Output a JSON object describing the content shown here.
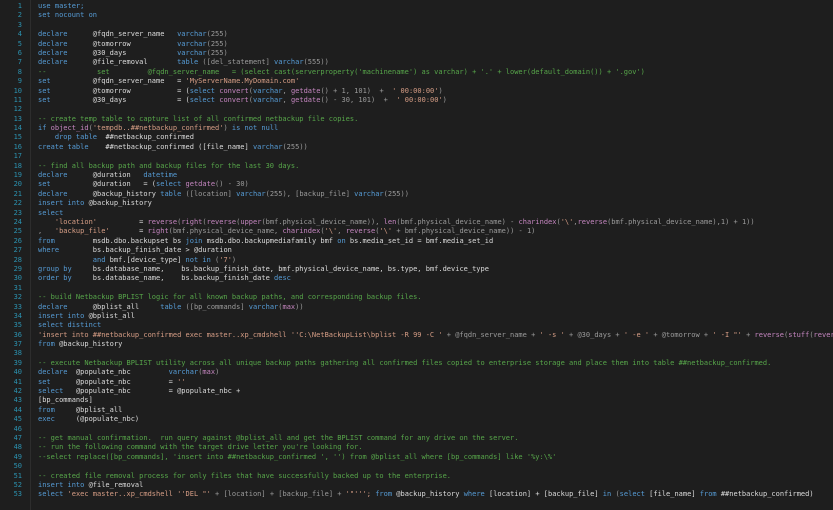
{
  "colors": {
    "background": "#1e1e1e",
    "line_number": "#2b91af",
    "keyword": "#569cd6",
    "string": "#d69d85",
    "comment": "#57a64a",
    "function": "#d4b35c",
    "text": "#dcdcdc"
  },
  "lines": [
    {
      "n": "1",
      "tokens": [
        {
          "t": "k",
          "v": "use master;"
        }
      ]
    },
    {
      "n": "2",
      "tokens": [
        {
          "t": "k",
          "v": "set nocount on"
        }
      ]
    },
    {
      "n": "3",
      "tokens": []
    },
    {
      "n": "4",
      "tokens": [
        {
          "t": "k",
          "v": "declare"
        },
        {
          "t": "v",
          "v": "      @fqdn_server_name   "
        },
        {
          "t": "k",
          "v": "varchar"
        },
        {
          "t": "o",
          "v": "(255)"
        }
      ]
    },
    {
      "n": "5",
      "tokens": [
        {
          "t": "k",
          "v": "declare"
        },
        {
          "t": "v",
          "v": "      @tomorrow           "
        },
        {
          "t": "k",
          "v": "varchar"
        },
        {
          "t": "o",
          "v": "(255)"
        }
      ]
    },
    {
      "n": "6",
      "tokens": [
        {
          "t": "k",
          "v": "declare"
        },
        {
          "t": "v",
          "v": "      @30_days            "
        },
        {
          "t": "k",
          "v": "varchar"
        },
        {
          "t": "o",
          "v": "(255)"
        }
      ]
    },
    {
      "n": "7",
      "tokens": [
        {
          "t": "k",
          "v": "declare"
        },
        {
          "t": "v",
          "v": "      @file_removal       "
        },
        {
          "t": "k",
          "v": "table"
        },
        {
          "t": "o",
          "v": " ([del_statement] "
        },
        {
          "t": "k",
          "v": "varchar"
        },
        {
          "t": "o",
          "v": "(555))"
        }
      ]
    },
    {
      "n": "8",
      "tokens": [
        {
          "t": "c",
          "v": "--            set         @fqdn_server_name   = (select cast(serverproperty('machinename') as varchar) + '.' + lower(default_domain()) + '.gov')"
        }
      ]
    },
    {
      "n": "9",
      "tokens": [
        {
          "t": "k",
          "v": "set"
        },
        {
          "t": "v",
          "v": "          @fqdn_server_name   = "
        },
        {
          "t": "s",
          "v": "'MyServerName.MyDomain.com'"
        }
      ]
    },
    {
      "n": "10",
      "tokens": [
        {
          "t": "k",
          "v": "set"
        },
        {
          "t": "v",
          "v": "          @tomorrow           = ("
        },
        {
          "t": "k",
          "v": "select"
        },
        {
          "t": "v",
          "v": " "
        },
        {
          "t": "g",
          "v": "convert"
        },
        {
          "t": "o",
          "v": "("
        },
        {
          "t": "k",
          "v": "varchar"
        },
        {
          "t": "o",
          "v": ", "
        },
        {
          "t": "g",
          "v": "getdate"
        },
        {
          "t": "o",
          "v": "() + 1, 101)  +  "
        },
        {
          "t": "s",
          "v": "' 00:00:00'"
        },
        {
          "t": "o",
          "v": ")"
        }
      ]
    },
    {
      "n": "11",
      "tokens": [
        {
          "t": "k",
          "v": "set"
        },
        {
          "t": "v",
          "v": "          @30_days            = ("
        },
        {
          "t": "k",
          "v": "select"
        },
        {
          "t": "v",
          "v": " "
        },
        {
          "t": "g",
          "v": "convert"
        },
        {
          "t": "o",
          "v": "("
        },
        {
          "t": "k",
          "v": "varchar"
        },
        {
          "t": "o",
          "v": ", "
        },
        {
          "t": "g",
          "v": "getdate"
        },
        {
          "t": "o",
          "v": "() - 30, 101)  +  "
        },
        {
          "t": "s",
          "v": "' 00:00:00'"
        },
        {
          "t": "o",
          "v": ")"
        }
      ]
    },
    {
      "n": "12",
      "tokens": []
    },
    {
      "n": "13",
      "tokens": [
        {
          "t": "c",
          "v": "-- create temp table to capture list of all confirmed netbackup file copies."
        }
      ]
    },
    {
      "n": "14",
      "tokens": [
        {
          "t": "k",
          "v": "if"
        },
        {
          "t": "v",
          "v": " "
        },
        {
          "t": "g",
          "v": "object_id"
        },
        {
          "t": "o",
          "v": "("
        },
        {
          "t": "s",
          "v": "'tempdb..##netbackup_confirmed'"
        },
        {
          "t": "o",
          "v": ") "
        },
        {
          "t": "k",
          "v": "is not null"
        }
      ]
    },
    {
      "n": "15",
      "tokens": [
        {
          "t": "v",
          "v": "    "
        },
        {
          "t": "k",
          "v": "drop table"
        },
        {
          "t": "v",
          "v": "  ##netbackup_confirmed"
        }
      ]
    },
    {
      "n": "16",
      "tokens": [
        {
          "t": "k",
          "v": "create table"
        },
        {
          "t": "v",
          "v": "    ##netbackup_confirmed ([file_name] "
        },
        {
          "t": "k",
          "v": "varchar"
        },
        {
          "t": "o",
          "v": "(255))"
        }
      ]
    },
    {
      "n": "17",
      "tokens": []
    },
    {
      "n": "18",
      "tokens": [
        {
          "t": "c",
          "v": "-- find all backup path and backup files for the last 30 days."
        }
      ]
    },
    {
      "n": "19",
      "tokens": [
        {
          "t": "k",
          "v": "declare"
        },
        {
          "t": "v",
          "v": "      @duration   "
        },
        {
          "t": "k",
          "v": "datetime"
        }
      ]
    },
    {
      "n": "20",
      "tokens": [
        {
          "t": "k",
          "v": "set"
        },
        {
          "t": "v",
          "v": "          @duration   = ("
        },
        {
          "t": "k",
          "v": "select"
        },
        {
          "t": "v",
          "v": " "
        },
        {
          "t": "g",
          "v": "getdate"
        },
        {
          "t": "o",
          "v": "() - 30)"
        }
      ]
    },
    {
      "n": "21",
      "tokens": [
        {
          "t": "k",
          "v": "declare"
        },
        {
          "t": "v",
          "v": "      @backup_history "
        },
        {
          "t": "k",
          "v": "table"
        },
        {
          "t": "o",
          "v": " ([location] "
        },
        {
          "t": "k",
          "v": "varchar"
        },
        {
          "t": "o",
          "v": "(255), [backup_file] "
        },
        {
          "t": "k",
          "v": "varchar"
        },
        {
          "t": "o",
          "v": "(255))"
        }
      ]
    },
    {
      "n": "22",
      "tokens": [
        {
          "t": "k",
          "v": "insert into"
        },
        {
          "t": "v",
          "v": " @backup_history"
        }
      ]
    },
    {
      "n": "23",
      "tokens": [
        {
          "t": "k",
          "v": "select"
        }
      ]
    },
    {
      "n": "24",
      "tokens": [
        {
          "t": "v",
          "v": "    "
        },
        {
          "t": "s",
          "v": "'location'"
        },
        {
          "t": "v",
          "v": "          = "
        },
        {
          "t": "g",
          "v": "reverse"
        },
        {
          "t": "o",
          "v": "("
        },
        {
          "t": "g",
          "v": "right"
        },
        {
          "t": "o",
          "v": "("
        },
        {
          "t": "g",
          "v": "reverse"
        },
        {
          "t": "o",
          "v": "("
        },
        {
          "t": "g",
          "v": "upper"
        },
        {
          "t": "o",
          "v": "(bmf.physical_device_name)), "
        },
        {
          "t": "g",
          "v": "len"
        },
        {
          "t": "o",
          "v": "(bmf.physical_device_name) - "
        },
        {
          "t": "g",
          "v": "charindex"
        },
        {
          "t": "o",
          "v": "("
        },
        {
          "t": "s",
          "v": "'\\'"
        },
        {
          "t": "o",
          "v": ","
        },
        {
          "t": "g",
          "v": "reverse"
        },
        {
          "t": "o",
          "v": "(bmf.physical_device_name),1) + 1))"
        }
      ]
    },
    {
      "n": "25",
      "tokens": [
        {
          "t": "o",
          "v": ",   "
        },
        {
          "t": "s",
          "v": "'backup_file'"
        },
        {
          "t": "v",
          "v": "       = "
        },
        {
          "t": "g",
          "v": "right"
        },
        {
          "t": "o",
          "v": "(bmf.physical_device_name, "
        },
        {
          "t": "g",
          "v": "charindex"
        },
        {
          "t": "o",
          "v": "("
        },
        {
          "t": "s",
          "v": "'\\'"
        },
        {
          "t": "o",
          "v": ", "
        },
        {
          "t": "g",
          "v": "reverse"
        },
        {
          "t": "o",
          "v": "("
        },
        {
          "t": "s",
          "v": "'\\'"
        },
        {
          "t": "o",
          "v": " + bmf.physical_device_name)) - 1)"
        }
      ]
    },
    {
      "n": "26",
      "tokens": [
        {
          "t": "k",
          "v": "from"
        },
        {
          "t": "v",
          "v": "         msdb.dbo.backupset bs "
        },
        {
          "t": "k",
          "v": "join"
        },
        {
          "t": "v",
          "v": " msdb.dbo.backupmediafamily bmf "
        },
        {
          "t": "k",
          "v": "on"
        },
        {
          "t": "v",
          "v": " bs.media_set_id = bmf.media_set_id"
        }
      ]
    },
    {
      "n": "27",
      "tokens": [
        {
          "t": "k",
          "v": "where"
        },
        {
          "t": "v",
          "v": "        bs.backup_finish_date > @duration"
        }
      ]
    },
    {
      "n": "28",
      "tokens": [
        {
          "t": "v",
          "v": "             "
        },
        {
          "t": "k",
          "v": "and"
        },
        {
          "t": "v",
          "v": " bmf.[device_type] "
        },
        {
          "t": "k",
          "v": "not in"
        },
        {
          "t": "o",
          "v": " ("
        },
        {
          "t": "s",
          "v": "'7'"
        },
        {
          "t": "o",
          "v": ")"
        }
      ]
    },
    {
      "n": "29",
      "tokens": [
        {
          "t": "k",
          "v": "group by"
        },
        {
          "t": "v",
          "v": "     bs.database_name,    bs.backup_finish_date, bmf.physical_device_name, bs.type, bmf.device_type"
        }
      ]
    },
    {
      "n": "30",
      "tokens": [
        {
          "t": "k",
          "v": "order by"
        },
        {
          "t": "v",
          "v": "     bs.database_name,    bs.backup_finish_date "
        },
        {
          "t": "k",
          "v": "desc"
        }
      ]
    },
    {
      "n": "31",
      "tokens": []
    },
    {
      "n": "32",
      "tokens": [
        {
          "t": "c",
          "v": "-- build Netbackup BPLIST logic for all known backup paths, and corresponding backup files."
        }
      ]
    },
    {
      "n": "33",
      "tokens": [
        {
          "t": "k",
          "v": "declare"
        },
        {
          "t": "v",
          "v": "      @bplist_all     "
        },
        {
          "t": "k",
          "v": "table"
        },
        {
          "t": "o",
          "v": " ([bp_commands] "
        },
        {
          "t": "k",
          "v": "varchar"
        },
        {
          "t": "o",
          "v": "("
        },
        {
          "t": "g",
          "v": "max"
        },
        {
          "t": "o",
          "v": "))"
        }
      ]
    },
    {
      "n": "34",
      "tokens": [
        {
          "t": "k",
          "v": "insert into"
        },
        {
          "t": "v",
          "v": " @bplist_all"
        }
      ]
    },
    {
      "n": "35",
      "tokens": [
        {
          "t": "k",
          "v": "select distinct"
        }
      ]
    },
    {
      "n": "36",
      "tokens": [
        {
          "t": "s",
          "v": "'insert into ##netbackup_confirmed exec master..xp_cmdshell ''C:\\NetBackupList\\bplist -R 99 -C '"
        },
        {
          "t": "o",
          "v": " + @fqdn_server_name + "
        },
        {
          "t": "s",
          "v": "' -s '"
        },
        {
          "t": "o",
          "v": " + @30_days + "
        },
        {
          "t": "s",
          "v": "' -e '"
        },
        {
          "t": "o",
          "v": " + @tomorrow + "
        },
        {
          "t": "s",
          "v": "' -I \"'"
        },
        {
          "t": "o",
          "v": " + "
        },
        {
          "t": "g",
          "v": "reverse"
        },
        {
          "t": "o",
          "v": "("
        },
        {
          "t": "g",
          "v": "stuff"
        },
        {
          "t": "o",
          "v": "("
        },
        {
          "t": "g",
          "v": "reverse"
        },
        {
          "t": "o",
          "v": "([lo"
        }
      ]
    },
    {
      "n": "37",
      "tokens": [
        {
          "t": "k",
          "v": "from"
        },
        {
          "t": "v",
          "v": " @backup_history"
        }
      ]
    },
    {
      "n": "38",
      "tokens": []
    },
    {
      "n": "39",
      "tokens": [
        {
          "t": "c",
          "v": "-- execute Netbackup BPLIST utility across all unique backup paths gathering all confirmed files copied to enterprise storage and place them into table ##netbackup_confirmed."
        }
      ]
    },
    {
      "n": "40",
      "tokens": [
        {
          "t": "k",
          "v": "declare"
        },
        {
          "t": "v",
          "v": "  @populate_nbc         "
        },
        {
          "t": "k",
          "v": "varchar"
        },
        {
          "t": "o",
          "v": "("
        },
        {
          "t": "g",
          "v": "max"
        },
        {
          "t": "o",
          "v": ")"
        }
      ]
    },
    {
      "n": "41",
      "tokens": [
        {
          "t": "k",
          "v": "set"
        },
        {
          "t": "v",
          "v": "      @populate_nbc         = "
        },
        {
          "t": "s",
          "v": "''"
        }
      ]
    },
    {
      "n": "42",
      "tokens": [
        {
          "t": "k",
          "v": "select"
        },
        {
          "t": "v",
          "v": "   @populate_nbc         = @populate_nbc +"
        }
      ]
    },
    {
      "n": "43",
      "tokens": [
        {
          "t": "v",
          "v": "[bp_commands]"
        }
      ]
    },
    {
      "n": "44",
      "tokens": [
        {
          "t": "k",
          "v": "from"
        },
        {
          "t": "v",
          "v": "     @bplist_all"
        }
      ]
    },
    {
      "n": "45",
      "tokens": [
        {
          "t": "k",
          "v": "exec"
        },
        {
          "t": "v",
          "v": "     (@populate_nbc)"
        }
      ]
    },
    {
      "n": "46",
      "tokens": []
    },
    {
      "n": "47",
      "tokens": [
        {
          "t": "c",
          "v": "-- get manual confirmation.  run query against @bplist_all and get the BPLIST command for any drive on the server."
        }
      ]
    },
    {
      "n": "48",
      "tokens": [
        {
          "t": "c",
          "v": "-- run the following command with the target drive letter you're looking for."
        }
      ]
    },
    {
      "n": "49",
      "tokens": [
        {
          "t": "c",
          "v": "--select replace([bp_commands], 'insert into ##netbackup_confirmed ', '') from @bplist_all where [bp_commands] like '%y:\\%'"
        }
      ]
    },
    {
      "n": "50",
      "tokens": []
    },
    {
      "n": "51",
      "tokens": [
        {
          "t": "c",
          "v": "-- created file removal process for only files that have successfully backed up to the enterprise."
        }
      ]
    },
    {
      "n": "52",
      "tokens": [
        {
          "t": "k",
          "v": "insert into"
        },
        {
          "t": "v",
          "v": " @file_removal"
        }
      ]
    },
    {
      "n": "53",
      "tokens": [
        {
          "t": "k",
          "v": "select"
        },
        {
          "t": "v",
          "v": " "
        },
        {
          "t": "s",
          "v": "'exec master..xp_cmdshell ''DEL \"'"
        },
        {
          "t": "o",
          "v": " + [location] + [backup_file] + "
        },
        {
          "t": "s",
          "v": "'\"''';"
        },
        {
          "t": "o",
          "v": " "
        },
        {
          "t": "k",
          "v": "from"
        },
        {
          "t": "v",
          "v": " @backup_history "
        },
        {
          "t": "k",
          "v": "where"
        },
        {
          "t": "v",
          "v": " [location] + [backup_file] "
        },
        {
          "t": "k",
          "v": "in"
        },
        {
          "t": "o",
          "v": " ("
        },
        {
          "t": "k",
          "v": "select"
        },
        {
          "t": "v",
          "v": " [file_name] "
        },
        {
          "t": "k",
          "v": "from"
        },
        {
          "t": "v",
          "v": " ##netbackup_confirmed)"
        }
      ]
    }
  ]
}
